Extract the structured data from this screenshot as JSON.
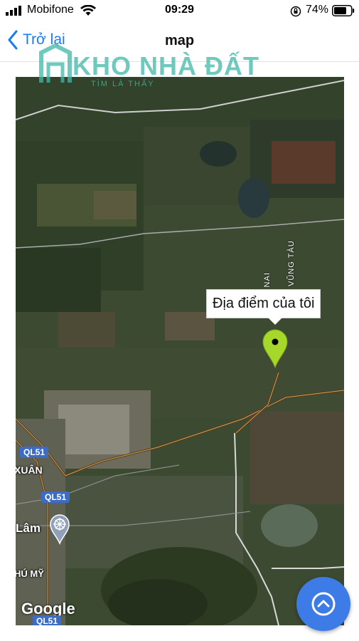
{
  "status_bar": {
    "carrier": "Mobifone",
    "time": "09:29",
    "battery_percent": "74%"
  },
  "nav": {
    "back_label": "Trở lại",
    "title": "map"
  },
  "watermark": {
    "brand_main": "KHO NHÀ ĐẤT",
    "brand_sub": "TÌM LÀ THẤY"
  },
  "map": {
    "marker_callout": "Địa điểm của tôi",
    "road_labels": [
      "QL51",
      "QL51",
      "QL51"
    ],
    "place_labels": [
      "XUÂN",
      "Lâm",
      "HÚ MỸ"
    ],
    "vertical_labels": [
      "NG NAI",
      "VŨNG TÀU"
    ],
    "attribution": "Google"
  },
  "colors": {
    "accent": "#1a7cf5",
    "marker": "#a6d82b",
    "fab": "#3d7be6",
    "road_shield": "#3b6cc8"
  }
}
